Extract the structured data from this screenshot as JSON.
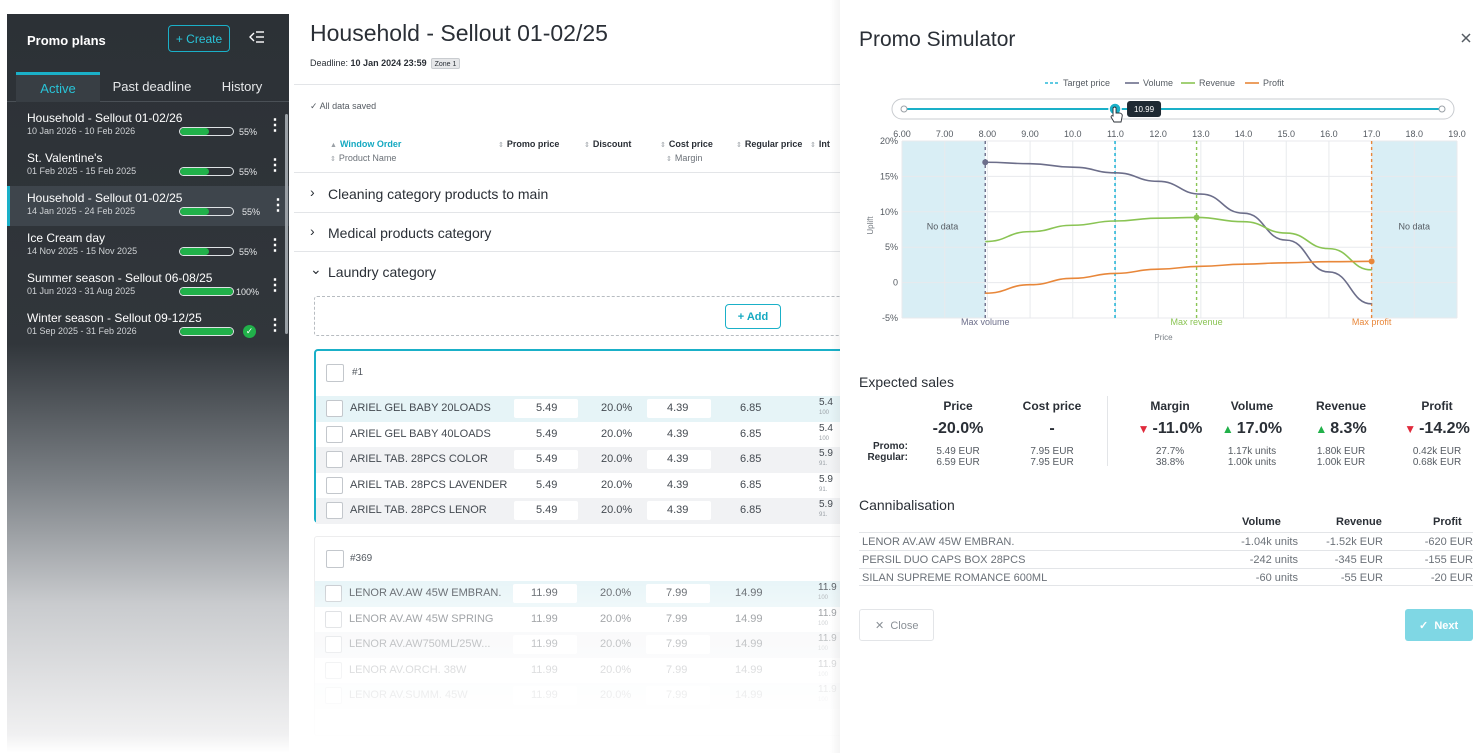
{
  "sidebar": {
    "title": "Promo plans",
    "create_label": "+ Create",
    "collapse_icon": "collapse-left-icon",
    "tabs": [
      {
        "label": "Active",
        "active": true
      },
      {
        "label": "Past deadline"
      },
      {
        "label": "History"
      }
    ],
    "plans": [
      {
        "name": "Household - Sellout 01-02/26",
        "dates": "10 Jan 2026 - 10 Feb 2026",
        "progress": 55,
        "progress_label": "55%"
      },
      {
        "name": "St. Valentine's",
        "dates": "01 Feb 2025 - 15 Feb 2025",
        "progress": 55,
        "progress_label": "55%"
      },
      {
        "name": "Household - Sellout 01-02/25",
        "dates": "14 Jan 2025 - 24 Feb 2025",
        "progress": 55,
        "progress_label": "55%",
        "active": true
      },
      {
        "name": "Ice Cream day",
        "dates": "14 Nov 2025 - 15 Nov 2025",
        "progress": 55,
        "progress_label": "55%"
      },
      {
        "name": "Summer season - Sellout 06-08/25",
        "dates": "01 Jun 2023 - 31 Aug 2025",
        "progress": 100,
        "progress_label": "100%"
      },
      {
        "name": "Winter season - Sellout 09-12/25",
        "dates": "01 Sep 2025 - 31 Feb 2026",
        "progress": 100,
        "complete": true
      }
    ]
  },
  "main": {
    "title": "Household - Sellout 01-02/25",
    "deadline_label": "Deadline:",
    "deadline_value": "10 Jan 2024 23:59",
    "zone": "Zone 1",
    "saved_status": "All data saved",
    "columns": {
      "window_order": "Window Order",
      "product_name": "Product Name",
      "promo_price": "Promo price",
      "discount": "Discount",
      "cost_price": "Cost price",
      "margin": "Margin",
      "regular_price": "Regular price",
      "int": "Int"
    },
    "categories": [
      {
        "name": "Cleaning category products to main",
        "expanded": false
      },
      {
        "name": "Medical products category",
        "expanded": false
      },
      {
        "name": "Laundry category",
        "expanded": true
      }
    ],
    "add_label": "+ Add",
    "groups": [
      {
        "number": "#1",
        "rows": [
          {
            "product": "ARIEL GEL BABY 20LOADS",
            "promo": "5.49",
            "discount": "20.0%",
            "cost": "4.39",
            "regular": "6.85",
            "micro": "5.4",
            "micro_sub": "100"
          },
          {
            "product": "ARIEL GEL BABY 40LOADS",
            "promo": "5.49",
            "discount": "20.0%",
            "cost": "4.39",
            "regular": "6.85",
            "micro": "5.4",
            "micro_sub": "100"
          },
          {
            "product": "ARIEL TAB. 28PCS COLOR",
            "promo": "5.49",
            "discount": "20.0%",
            "cost": "4.39",
            "regular": "6.85",
            "micro": "5.9",
            "micro_sub": "91."
          },
          {
            "product": "ARIEL TAB. 28PCS LAVENDER",
            "promo": "5.49",
            "discount": "20.0%",
            "cost": "4.39",
            "regular": "6.85",
            "micro": "5.9",
            "micro_sub": "91."
          },
          {
            "product": "ARIEL TAB. 28PCS LENOR",
            "promo": "5.49",
            "discount": "20.0%",
            "cost": "4.39",
            "regular": "6.85",
            "micro": "5.9",
            "micro_sub": "91."
          }
        ]
      },
      {
        "number": "#369",
        "rows": [
          {
            "product": "LENOR AV.AW 45W EMBRAN.",
            "promo": "11.99",
            "discount": "20.0%",
            "cost": "7.99",
            "regular": "14.99",
            "micro": "11.9",
            "micro_sub": "100"
          },
          {
            "product": "LENOR AV.AW 45W SPRING",
            "promo": "11.99",
            "discount": "20.0%",
            "cost": "7.99",
            "regular": "14.99",
            "micro": "11.9",
            "micro_sub": "100"
          },
          {
            "product": "LENOR AV.AW750ML/25W...",
            "promo": "11.99",
            "discount": "20.0%",
            "cost": "7.99",
            "regular": "14.99",
            "micro": "11.9",
            "micro_sub": "100"
          },
          {
            "product": "LENOR AV.ORCH. 38W",
            "promo": "11.99",
            "discount": "20.0%",
            "cost": "7.99",
            "regular": "14.99",
            "micro": "11.9",
            "micro_sub": "100"
          },
          {
            "product": "LENOR AV.SUMM. 45W",
            "promo": "11.99",
            "discount": "20.0%",
            "cost": "7.99",
            "regular": "14.99",
            "micro": "11.9",
            "micro_sub": "100"
          }
        ]
      }
    ]
  },
  "simulator": {
    "title": "Promo Simulator",
    "close_icon": "close-icon",
    "chart_data": {
      "type": "line",
      "xlabel": "Price",
      "ylabel": "Uplift",
      "xlim": [
        6.0,
        19.0
      ],
      "ylim": [
        -5,
        20
      ],
      "x_ticks": [
        "6.00",
        "7.00",
        "8.00",
        "9.00",
        "10.0",
        "11.0",
        "12.0",
        "13.0",
        "14.0",
        "15.0",
        "16.0",
        "17.0",
        "18.0",
        "19.0"
      ],
      "y_ticks": [
        "20%",
        "15%",
        "10%",
        "5%",
        "0",
        "-5%"
      ],
      "legend": [
        "Target price",
        "Volume",
        "Revenue",
        "Profit"
      ],
      "legend_position": "top",
      "no_data_label": "No data",
      "no_data_ranges": [
        [
          6.0,
          7.95
        ],
        [
          17.0,
          19.0
        ]
      ],
      "slider_value": 10.99,
      "slider_label": "10.99",
      "target_price": 10.99,
      "markers": [
        {
          "label": "Max volume",
          "x": 7.95,
          "color": "#6c6e8a"
        },
        {
          "label": "Max revenue",
          "x": 12.9,
          "color": "#8ac454"
        },
        {
          "label": "Max profit",
          "x": 17.0,
          "color": "#e8873a"
        }
      ],
      "series": [
        {
          "name": "Volume",
          "color": "#6c6e8a",
          "x": [
            7.95,
            9,
            10,
            11,
            12,
            13,
            14,
            15,
            16,
            17
          ],
          "y": [
            17.0,
            16.8,
            16.3,
            15.5,
            14.3,
            12.5,
            9.8,
            6.0,
            1.5,
            -3.0
          ]
        },
        {
          "name": "Revenue",
          "color": "#8ac454",
          "x": [
            7.95,
            9,
            10,
            11,
            12,
            12.9,
            14,
            15,
            16,
            17
          ],
          "y": [
            5.8,
            7.2,
            8.1,
            8.7,
            9.1,
            9.2,
            8.6,
            7.0,
            4.8,
            1.8
          ]
        },
        {
          "name": "Profit",
          "color": "#e8873a",
          "x": [
            7.95,
            9,
            10,
            11,
            12,
            13,
            14,
            15,
            16,
            17
          ],
          "y": [
            -1.5,
            -0.3,
            0.6,
            1.3,
            1.9,
            2.3,
            2.6,
            2.8,
            2.95,
            3.0
          ]
        }
      ],
      "target_color": "#2ab8d8"
    },
    "expected": {
      "title": "Expected sales",
      "row_labels": [
        "Promo:",
        "Regular:"
      ],
      "columns": [
        {
          "name": "Price",
          "pct": "-20.0%",
          "trend": "",
          "promo": "5.49 EUR",
          "regular": "6.59 EUR"
        },
        {
          "name": "Cost price",
          "pct": "-",
          "trend": "",
          "promo": "7.95 EUR",
          "regular": "7.95 EUR"
        },
        {
          "name": "Margin",
          "pct": "-11.0%",
          "trend": "down",
          "promo": "27.7%",
          "regular": "38.8%"
        },
        {
          "name": "Volume",
          "pct": "17.0%",
          "trend": "up",
          "promo": "1.17k units",
          "regular": "1.00k units"
        },
        {
          "name": "Revenue",
          "pct": "8.3%",
          "trend": "up",
          "promo": "1.80k EUR",
          "regular": "1.00k EUR"
        },
        {
          "name": "Profit",
          "pct": "-14.2%",
          "trend": "down",
          "promo": "0.42k EUR",
          "regular": "0.68k EUR"
        }
      ]
    },
    "cannibalisation": {
      "title": "Cannibalisation",
      "headers": [
        "Volume",
        "Revenue",
        "Profit"
      ],
      "rows": [
        {
          "product": "LENOR AV.AW 45W EMBRAN.",
          "volume": "-1.04k units",
          "revenue": "-1.52k EUR",
          "profit": "-620 EUR"
        },
        {
          "product": "PERSIL DUO CAPS BOX 28PCS",
          "volume": "-242 units",
          "revenue": "-345 EUR",
          "profit": "-155 EUR"
        },
        {
          "product": "SILAN SUPREME ROMANCE 600ML",
          "volume": "-60 units",
          "revenue": "-55 EUR",
          "profit": "-20 EUR"
        }
      ]
    },
    "close_label": "Close",
    "next_label": "Next",
    "colors": {
      "accent": "#1ab0c8",
      "up": "#21b14a",
      "down": "#e02b3c"
    }
  }
}
